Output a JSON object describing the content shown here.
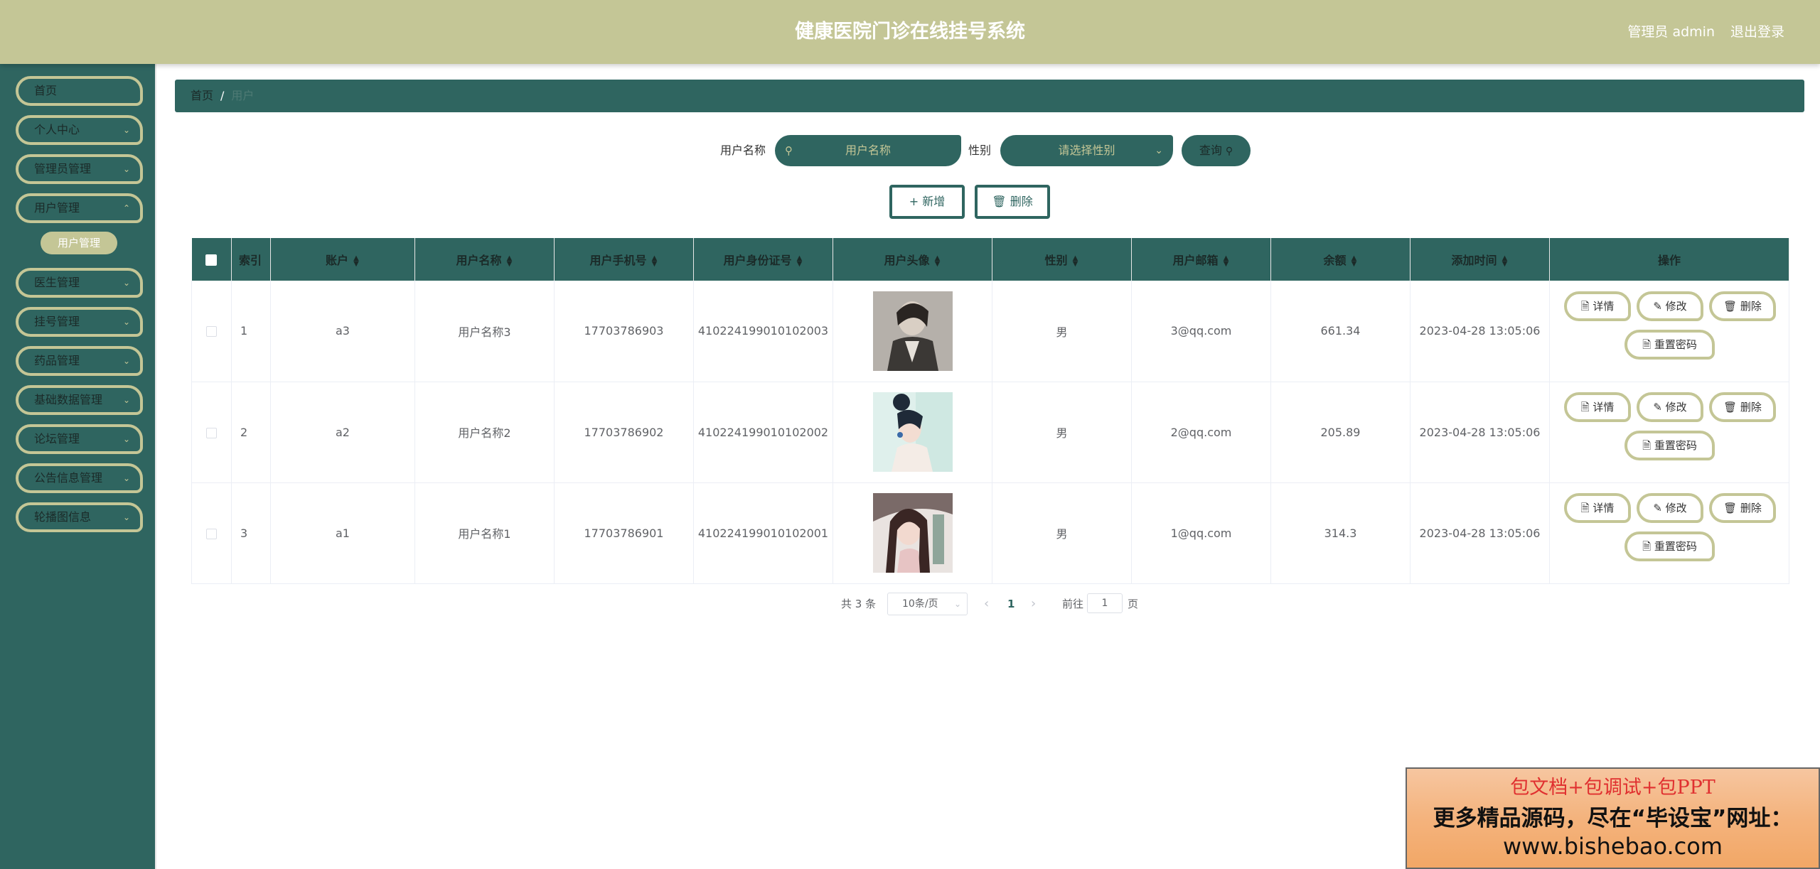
{
  "header": {
    "title": "健康医院门诊在线挂号系统",
    "admin": "管理员 admin",
    "logout": "退出登录"
  },
  "sidebar": {
    "items": [
      {
        "label": "首页"
      },
      {
        "label": "个人中心"
      },
      {
        "label": "管理员管理"
      },
      {
        "label": "用户管理"
      },
      {
        "label": "医生管理"
      },
      {
        "label": "挂号管理"
      },
      {
        "label": "药品管理"
      },
      {
        "label": "基础数据管理"
      },
      {
        "label": "论坛管理"
      },
      {
        "label": "公告信息管理"
      },
      {
        "label": "轮播图信息"
      }
    ],
    "submenu": {
      "label": "用户管理"
    }
  },
  "breadcrumb": {
    "home": "首页",
    "sep": "/",
    "current": "用户"
  },
  "search": {
    "name_label": "用户名称",
    "name_placeholder": "用户名称",
    "gender_label": "性别",
    "gender_placeholder": "请选择性别",
    "query_label": "查询"
  },
  "toolbar": {
    "add_label": "新增",
    "delete_label": "删除"
  },
  "table": {
    "headers": [
      "索引",
      "账户",
      "用户名称",
      "用户手机号",
      "用户身份证号",
      "用户头像",
      "性别",
      "用户邮箱",
      "余额",
      "添加时间",
      "操作"
    ],
    "rows": [
      {
        "index": "1",
        "account": "a3",
        "name": "用户名称3",
        "phone": "17703786903",
        "idcard": "410224199010102003",
        "gender": "男",
        "email": "3@qq.com",
        "balance": "661.34",
        "time": "2023-04-28 13:05:06"
      },
      {
        "index": "2",
        "account": "a2",
        "name": "用户名称2",
        "phone": "17703786902",
        "idcard": "410224199010102002",
        "gender": "男",
        "email": "2@qq.com",
        "balance": "205.89",
        "time": "2023-04-28 13:05:06"
      },
      {
        "index": "3",
        "account": "a1",
        "name": "用户名称1",
        "phone": "17703786901",
        "idcard": "410224199010102001",
        "gender": "男",
        "email": "1@qq.com",
        "balance": "314.3",
        "time": "2023-04-28 13:05:06"
      }
    ],
    "actions": {
      "detail": "详情",
      "edit": "修改",
      "delete": "删除",
      "reset": "重置密码"
    }
  },
  "pagination": {
    "total": "共 3 条",
    "page_size": "10条/页",
    "current": "1",
    "goto_prefix": "前往",
    "goto_value": "1",
    "goto_suffix": "页"
  },
  "banner": {
    "line1": "包文档+包调试+包PPT",
    "line2": "更多精品源码，尽在“毕设宝”网址：",
    "line3": "www.bishebao.com"
  },
  "colors": {
    "primary": "#2f6560",
    "accent": "#c4c696"
  }
}
